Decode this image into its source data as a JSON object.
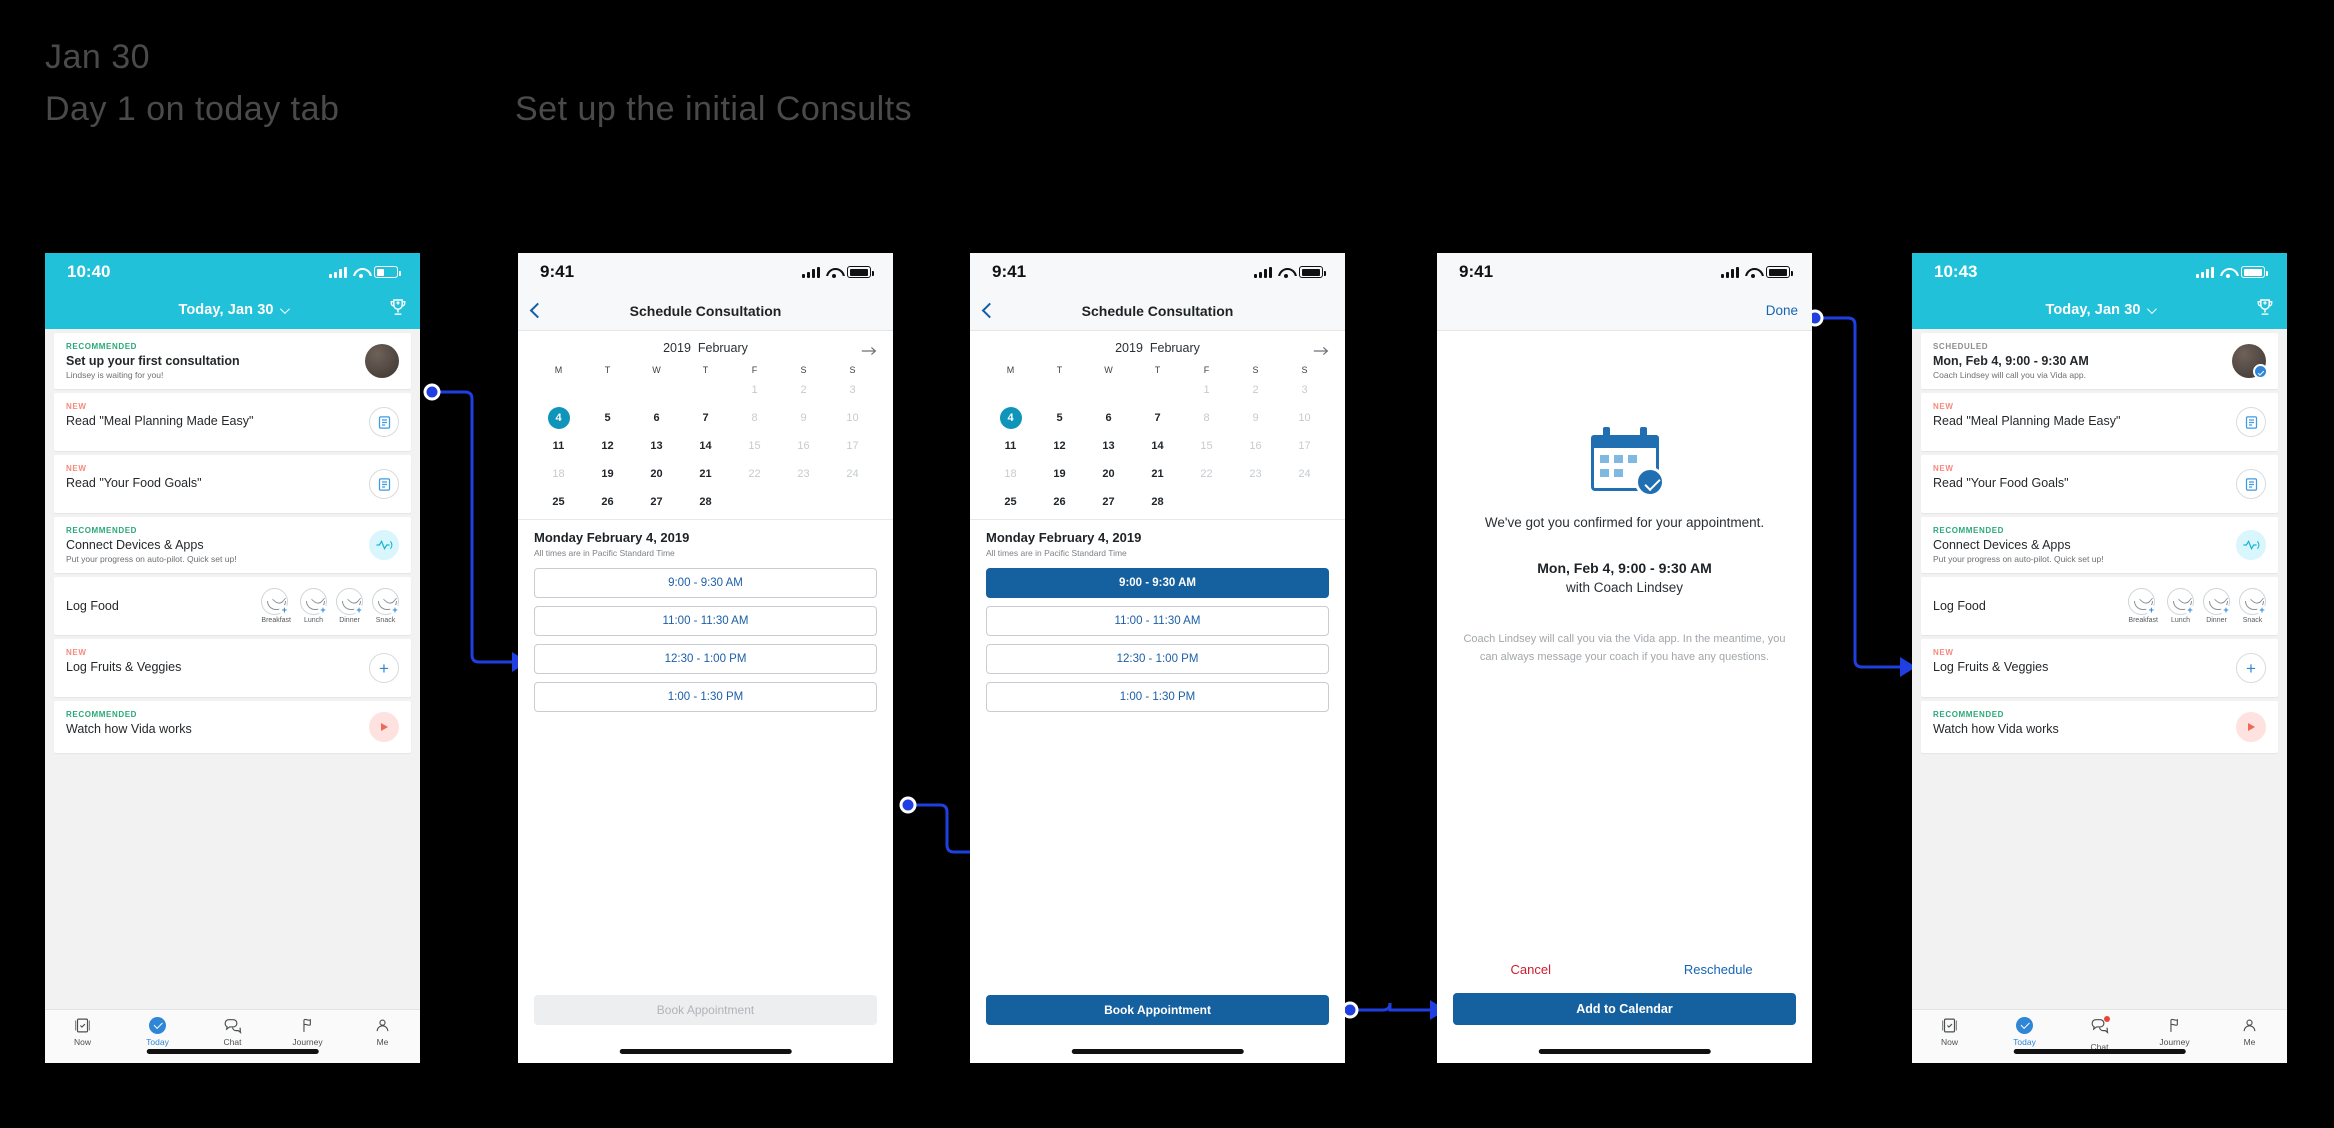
{
  "annotations": {
    "date": "Jan 30",
    "subtitle": "Day 1 on today tab",
    "flow_title": "Set up the initial Consults"
  },
  "colors": {
    "teal_header": "#22C1DA",
    "teal_selected_day": "#0F95BA",
    "blue_primary": "#15609F",
    "blue_link": "#1565B5",
    "red_cancel": "#D01C2E",
    "green_tag": "#2AA97A",
    "pink_tag": "#F58A7E",
    "connector_blue": "#1F3FE0"
  },
  "screen1": {
    "status_time": "10:40",
    "nav_title": "Today, Jan 30",
    "trophy_icon": "trophy-plus-icon",
    "cards": [
      {
        "tag": "RECOMMENDED",
        "tag_type": "rec",
        "title": "Set up your first consultation",
        "sub": "Lindsey is waiting for you!",
        "right": "avatar"
      },
      {
        "tag": "NEW",
        "tag_type": "new",
        "title": "Read \"Meal Planning Made Easy\"",
        "sub": "",
        "right": "article-icon"
      },
      {
        "tag": "NEW",
        "tag_type": "new",
        "title": "Read \"Your Food Goals\"",
        "sub": "",
        "right": "article-icon"
      },
      {
        "tag": "RECOMMENDED",
        "tag_type": "rec",
        "title": "Connect Devices & Apps",
        "sub": "Put your progress on auto-pilot. Quick set up!",
        "right": "pulse-icon"
      },
      {
        "tag": "",
        "tag_type": "",
        "title": "Log Food",
        "sub": "",
        "right": "meals"
      },
      {
        "tag": "NEW",
        "tag_type": "new",
        "title": "Log Fruits & Veggies",
        "sub": "",
        "right": "plus-icon"
      },
      {
        "tag": "RECOMMENDED",
        "tag_type": "rec",
        "title": "Watch how Vida works",
        "sub": "",
        "right": "play-icon"
      }
    ],
    "meals": [
      "Breakfast",
      "Lunch",
      "Dinner",
      "Snack"
    ],
    "tabs": [
      {
        "label": "Now",
        "icon": "checklist-icon",
        "active": false
      },
      {
        "label": "Today",
        "icon": "check-circle-icon",
        "active": true
      },
      {
        "label": "Chat",
        "icon": "chat-bubbles-icon",
        "active": false
      },
      {
        "label": "Journey",
        "icon": "flag-icon",
        "active": false
      },
      {
        "label": "Me",
        "icon": "person-icon",
        "active": false
      }
    ]
  },
  "screen2": {
    "status_time": "9:41",
    "nav_title": "Schedule Consultation",
    "back_icon": "chevron-left-icon",
    "next_month_icon": "arrow-right-icon",
    "calendar": {
      "year": "2019",
      "month": "February",
      "dow": [
        "M",
        "T",
        "W",
        "T",
        "F",
        "S",
        "S"
      ],
      "weeks": [
        [
          {
            "d": "",
            "s": "blank"
          },
          {
            "d": "",
            "s": "blank"
          },
          {
            "d": "",
            "s": "blank"
          },
          {
            "d": "",
            "s": "blank"
          },
          {
            "d": "1",
            "s": "muted"
          },
          {
            "d": "2",
            "s": "muted"
          },
          {
            "d": "3",
            "s": "muted"
          }
        ],
        [
          {
            "d": "4",
            "s": "selected"
          },
          {
            "d": "5",
            "s": "on"
          },
          {
            "d": "6",
            "s": "on"
          },
          {
            "d": "7",
            "s": "on"
          },
          {
            "d": "8",
            "s": "muted"
          },
          {
            "d": "9",
            "s": "muted"
          },
          {
            "d": "10",
            "s": "muted"
          }
        ],
        [
          {
            "d": "11",
            "s": "on"
          },
          {
            "d": "12",
            "s": "on"
          },
          {
            "d": "13",
            "s": "on"
          },
          {
            "d": "14",
            "s": "on"
          },
          {
            "d": "15",
            "s": "muted"
          },
          {
            "d": "16",
            "s": "muted"
          },
          {
            "d": "17",
            "s": "muted"
          }
        ],
        [
          {
            "d": "18",
            "s": "muted"
          },
          {
            "d": "19",
            "s": "on"
          },
          {
            "d": "20",
            "s": "on"
          },
          {
            "d": "21",
            "s": "on"
          },
          {
            "d": "22",
            "s": "muted"
          },
          {
            "d": "23",
            "s": "muted"
          },
          {
            "d": "24",
            "s": "muted"
          }
        ],
        [
          {
            "d": "25",
            "s": "on"
          },
          {
            "d": "26",
            "s": "on"
          },
          {
            "d": "27",
            "s": "on"
          },
          {
            "d": "28",
            "s": "on"
          },
          {
            "d": "",
            "s": "blank"
          },
          {
            "d": "",
            "s": "blank"
          },
          {
            "d": "",
            "s": "blank"
          }
        ]
      ]
    },
    "day_label": "Monday  February 4, 2019",
    "timezone_note": "All times are in Pacific Standard Time",
    "slots": [
      {
        "label": "9:00 - 9:30 AM",
        "selected": false
      },
      {
        "label": "11:00 - 11:30 AM",
        "selected": false
      },
      {
        "label": "12:30 - 1:00 PM",
        "selected": false
      },
      {
        "label": "1:00 - 1:30 PM",
        "selected": false
      }
    ],
    "book_label": "Book Appointment",
    "book_enabled": false
  },
  "screen3": {
    "status_time": "9:41",
    "nav_title": "Schedule Consultation",
    "back_icon": "chevron-left-icon",
    "next_month_icon": "arrow-right-icon",
    "day_label": "Monday  February 4, 2019",
    "timezone_note": "All times are in Pacific Standard Time",
    "slots": [
      {
        "label": "9:00 - 9:30 AM",
        "selected": true
      },
      {
        "label": "11:00 - 11:30 AM",
        "selected": false
      },
      {
        "label": "12:30 - 1:00 PM",
        "selected": false
      },
      {
        "label": "1:00 - 1:30 PM",
        "selected": false
      }
    ],
    "book_label": "Book Appointment",
    "book_enabled": true
  },
  "screen4": {
    "status_time": "9:41",
    "done_label": "Done",
    "icon": "calendar-check-icon",
    "headline": "We've got you confirmed for your appointment.",
    "appointment": "Mon, Feb 4, 9:00 - 9:30 AM",
    "coach": "with Coach Lindsey",
    "note": "Coach Lindsey will call you via the Vida app. In the meantime, you can always message your coach if you have any questions.",
    "cancel_label": "Cancel",
    "reschedule_label": "Reschedule",
    "add_to_calendar_label": "Add to Calendar"
  },
  "screen5": {
    "status_time": "10:43",
    "nav_title": "Today, Jan 30",
    "trophy_icon": "trophy-plus-icon",
    "cards": [
      {
        "tag": "SCHEDULED",
        "tag_type": "sched",
        "title": "Mon, Feb 4, 9:00 - 9:30 AM",
        "sub": "Coach Lindsey will call you via Vida app.",
        "right": "avatar-check"
      },
      {
        "tag": "NEW",
        "tag_type": "new",
        "title": "Read \"Meal Planning Made Easy\"",
        "sub": "",
        "right": "article-icon"
      },
      {
        "tag": "NEW",
        "tag_type": "new",
        "title": "Read \"Your Food Goals\"",
        "sub": "",
        "right": "article-icon"
      },
      {
        "tag": "RECOMMENDED",
        "tag_type": "rec",
        "title": "Connect Devices & Apps",
        "sub": "Put your progress on auto-pilot. Quick set up!",
        "right": "pulse-icon"
      },
      {
        "tag": "",
        "tag_type": "",
        "title": "Log Food",
        "sub": "",
        "right": "meals"
      },
      {
        "tag": "NEW",
        "tag_type": "new",
        "title": "Log Fruits & Veggies",
        "sub": "",
        "right": "plus-icon"
      },
      {
        "tag": "RECOMMENDED",
        "tag_type": "rec",
        "title": "Watch how Vida works",
        "sub": "",
        "right": "play-icon"
      }
    ],
    "meals": [
      "Breakfast",
      "Lunch",
      "Dinner",
      "Snack"
    ],
    "tabs": [
      {
        "label": "Now",
        "icon": "checklist-icon",
        "active": false
      },
      {
        "label": "Today",
        "icon": "check-circle-icon",
        "active": true
      },
      {
        "label": "Chat",
        "icon": "chat-bubbles-icon",
        "active": false
      },
      {
        "label": "Journey",
        "icon": "flag-icon",
        "active": false
      },
      {
        "label": "Me",
        "icon": "person-icon",
        "active": false
      }
    ]
  }
}
